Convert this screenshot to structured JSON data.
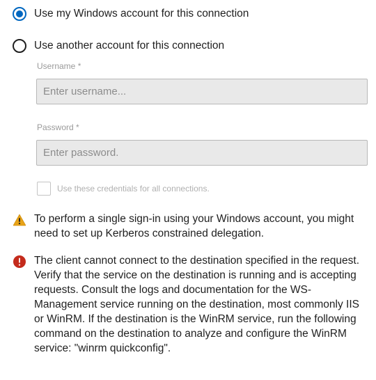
{
  "auth_options": {
    "windows_account": {
      "label": "Use my Windows account for this connection",
      "selected": true
    },
    "other_account": {
      "label": "Use another account for this connection",
      "selected": false
    }
  },
  "credentials": {
    "username_label": "Username",
    "username_placeholder": "Enter username...",
    "username_value": "",
    "password_label": "Password",
    "password_placeholder": "Enter password.",
    "password_value": "",
    "required_marker": "*",
    "use_for_all_label": "Use these credentials for all connections.",
    "use_for_all_checked": false
  },
  "messages": {
    "warning": {
      "icon": "warning-icon",
      "color": "#e8a317",
      "text": "To perform a single sign-in using your Windows account, you might need to set up Kerberos constrained delegation."
    },
    "error": {
      "icon": "error-icon",
      "color": "#c42b1c",
      "text": "The client cannot connect to the destination specified in the request. Verify that the service on the destination is running and is accepting requests. Consult the logs and documentation for the WS-Management service running on the destination, most commonly IIS or WinRM. If the destination is the WinRM service, run the following command on the destination to analyze and configure the WinRM service: \"winrm quickconfig\"."
    }
  },
  "colors": {
    "accent": "#0067c0",
    "disabled_input_bg": "#e9e9e9",
    "label_gray": "#9a9a9a"
  }
}
